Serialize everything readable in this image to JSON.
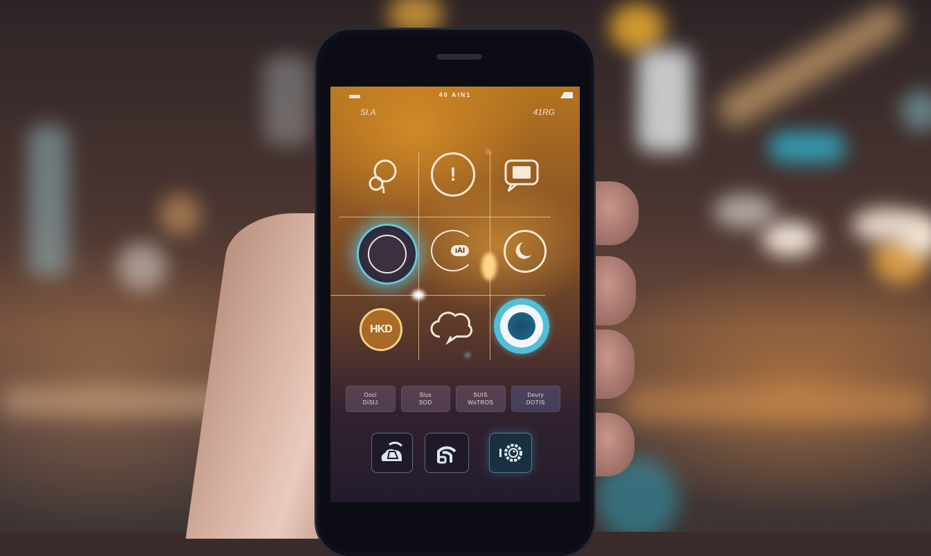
{
  "scene": {
    "description": "Hand holding a smartphone in front of a blurred city street at night with bokeh lights",
    "colors": {
      "screen_top": "#b4741f",
      "screen_bottom": "#231c2c",
      "accent_blue": "#5ac8e6",
      "accent_orange": "#f0a83c",
      "icon_stroke": "#f6ead8"
    }
  },
  "phone": {
    "status_bar": {
      "center_text": "40 AIN1",
      "left_icon": "battery-icon",
      "right_icon": "signal-icon"
    },
    "header": {
      "left": "SI.A",
      "right": "41RG"
    },
    "app_grid": [
      {
        "icon": "bubbles-icon"
      },
      {
        "icon": "alert-icon",
        "glyph": "!"
      },
      {
        "icon": "message-icon"
      },
      {
        "icon": "camera-lens-icon"
      },
      {
        "icon": "audio-badge-icon",
        "glyph": "ıAI"
      },
      {
        "icon": "moon-icon"
      },
      {
        "icon": "logo-badge-icon",
        "glyph": "HKD"
      },
      {
        "icon": "cloud-sync-icon"
      },
      {
        "icon": "record-icon"
      }
    ],
    "buttons": [
      {
        "line1": "Ooci",
        "line2": "DISIJ"
      },
      {
        "line1": "Slus",
        "line2": "SOD"
      },
      {
        "line1": "SUIS",
        "line2": "WoTROS"
      },
      {
        "line1": "Deury",
        "line2": "DOTIS"
      }
    ],
    "dock": [
      {
        "icon": "cloud-hat-icon"
      },
      {
        "icon": "wifi-feed-icon"
      },
      {
        "icon": "settings-gear-icon"
      }
    ]
  }
}
